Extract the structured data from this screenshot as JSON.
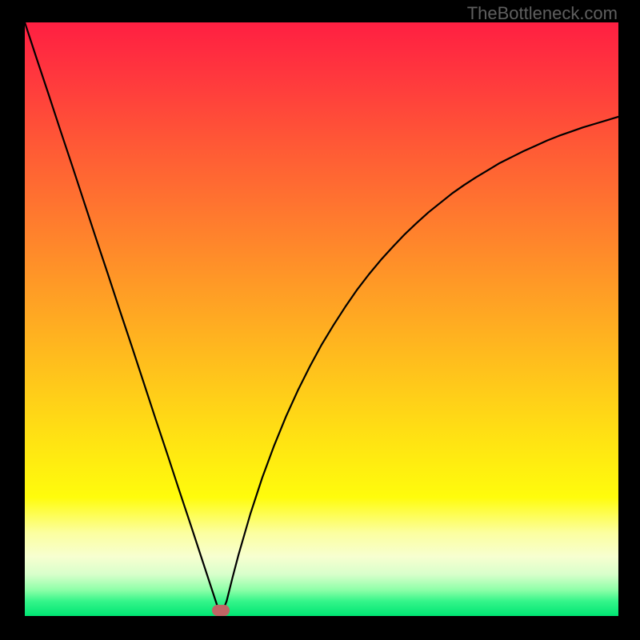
{
  "watermark": "TheBottleneck.com",
  "frame": {
    "outer_width": 800,
    "outer_height": 800,
    "inner_left": 31,
    "inner_top": 28,
    "inner_width": 742,
    "inner_height": 742
  },
  "gradient": {
    "stops": [
      {
        "offset": 0.0,
        "color": "#ff1f42"
      },
      {
        "offset": 0.1,
        "color": "#ff3a3d"
      },
      {
        "offset": 0.2,
        "color": "#ff5736"
      },
      {
        "offset": 0.3,
        "color": "#ff7230"
      },
      {
        "offset": 0.4,
        "color": "#ff8e29"
      },
      {
        "offset": 0.5,
        "color": "#ffaa22"
      },
      {
        "offset": 0.6,
        "color": "#ffc61b"
      },
      {
        "offset": 0.7,
        "color": "#ffe213"
      },
      {
        "offset": 0.8,
        "color": "#fffc0c"
      },
      {
        "offset": 0.86,
        "color": "#fcffa0"
      },
      {
        "offset": 0.9,
        "color": "#f7ffd0"
      },
      {
        "offset": 0.93,
        "color": "#d8ffcb"
      },
      {
        "offset": 0.956,
        "color": "#8effa8"
      },
      {
        "offset": 0.975,
        "color": "#35f58a"
      },
      {
        "offset": 1.0,
        "color": "#00e573"
      }
    ]
  },
  "chart_data": {
    "type": "line",
    "title": "",
    "xlabel": "",
    "ylabel": "",
    "x_range": [
      0,
      100
    ],
    "y_range": [
      0,
      100
    ],
    "x": [
      0,
      2,
      4,
      6,
      8,
      10,
      12,
      14,
      16,
      18,
      20,
      22,
      24,
      26,
      28,
      30,
      32,
      33,
      34,
      35,
      36,
      38,
      40,
      42,
      44,
      46,
      48,
      50,
      52,
      54,
      56,
      58,
      60,
      62,
      64,
      66,
      68,
      70,
      72,
      74,
      76,
      78,
      80,
      82,
      84,
      86,
      88,
      90,
      92,
      94,
      96,
      98,
      100
    ],
    "values": [
      100.0,
      93.9,
      87.9,
      81.8,
      75.8,
      69.7,
      63.6,
      57.6,
      51.5,
      45.5,
      39.4,
      33.3,
      27.3,
      21.2,
      15.2,
      9.1,
      3.0,
      0.0,
      2.5,
      6.5,
      10.3,
      17.2,
      23.3,
      28.7,
      33.6,
      38.0,
      42.0,
      45.7,
      49.0,
      52.1,
      55.0,
      57.6,
      60.0,
      62.2,
      64.3,
      66.2,
      68.0,
      69.6,
      71.2,
      72.6,
      73.9,
      75.1,
      76.3,
      77.3,
      78.3,
      79.2,
      80.1,
      80.9,
      81.6,
      82.3,
      82.9,
      83.5,
      84.1
    ],
    "min_point": {
      "x": 33,
      "y": 0
    },
    "annotation": "V-shaped bottleneck curve; 0% bottleneck near x≈33, rising on both sides. No numeric axis labels visible."
  },
  "marker": {
    "color": "#c06565",
    "x_pct": 33.0,
    "y_pct": 99.0
  }
}
